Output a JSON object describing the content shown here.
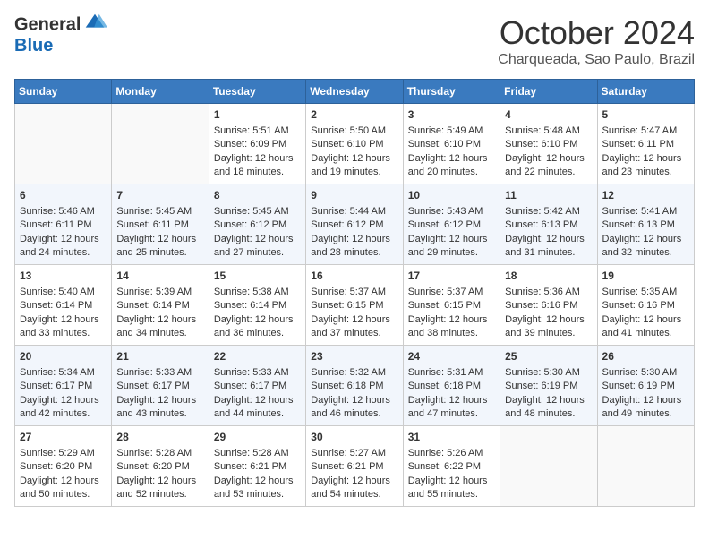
{
  "header": {
    "logo_line1": "General",
    "logo_line2": "Blue",
    "month_title": "October 2024",
    "subtitle": "Charqueada, Sao Paulo, Brazil"
  },
  "weekdays": [
    "Sunday",
    "Monday",
    "Tuesday",
    "Wednesday",
    "Thursday",
    "Friday",
    "Saturday"
  ],
  "weeks": [
    [
      {
        "day": "",
        "info": ""
      },
      {
        "day": "",
        "info": ""
      },
      {
        "day": "1",
        "info": "Sunrise: 5:51 AM\nSunset: 6:09 PM\nDaylight: 12 hours and 18 minutes."
      },
      {
        "day": "2",
        "info": "Sunrise: 5:50 AM\nSunset: 6:10 PM\nDaylight: 12 hours and 19 minutes."
      },
      {
        "day": "3",
        "info": "Sunrise: 5:49 AM\nSunset: 6:10 PM\nDaylight: 12 hours and 20 minutes."
      },
      {
        "day": "4",
        "info": "Sunrise: 5:48 AM\nSunset: 6:10 PM\nDaylight: 12 hours and 22 minutes."
      },
      {
        "day": "5",
        "info": "Sunrise: 5:47 AM\nSunset: 6:11 PM\nDaylight: 12 hours and 23 minutes."
      }
    ],
    [
      {
        "day": "6",
        "info": "Sunrise: 5:46 AM\nSunset: 6:11 PM\nDaylight: 12 hours and 24 minutes."
      },
      {
        "day": "7",
        "info": "Sunrise: 5:45 AM\nSunset: 6:11 PM\nDaylight: 12 hours and 25 minutes."
      },
      {
        "day": "8",
        "info": "Sunrise: 5:45 AM\nSunset: 6:12 PM\nDaylight: 12 hours and 27 minutes."
      },
      {
        "day": "9",
        "info": "Sunrise: 5:44 AM\nSunset: 6:12 PM\nDaylight: 12 hours and 28 minutes."
      },
      {
        "day": "10",
        "info": "Sunrise: 5:43 AM\nSunset: 6:12 PM\nDaylight: 12 hours and 29 minutes."
      },
      {
        "day": "11",
        "info": "Sunrise: 5:42 AM\nSunset: 6:13 PM\nDaylight: 12 hours and 31 minutes."
      },
      {
        "day": "12",
        "info": "Sunrise: 5:41 AM\nSunset: 6:13 PM\nDaylight: 12 hours and 32 minutes."
      }
    ],
    [
      {
        "day": "13",
        "info": "Sunrise: 5:40 AM\nSunset: 6:14 PM\nDaylight: 12 hours and 33 minutes."
      },
      {
        "day": "14",
        "info": "Sunrise: 5:39 AM\nSunset: 6:14 PM\nDaylight: 12 hours and 34 minutes."
      },
      {
        "day": "15",
        "info": "Sunrise: 5:38 AM\nSunset: 6:14 PM\nDaylight: 12 hours and 36 minutes."
      },
      {
        "day": "16",
        "info": "Sunrise: 5:37 AM\nSunset: 6:15 PM\nDaylight: 12 hours and 37 minutes."
      },
      {
        "day": "17",
        "info": "Sunrise: 5:37 AM\nSunset: 6:15 PM\nDaylight: 12 hours and 38 minutes."
      },
      {
        "day": "18",
        "info": "Sunrise: 5:36 AM\nSunset: 6:16 PM\nDaylight: 12 hours and 39 minutes."
      },
      {
        "day": "19",
        "info": "Sunrise: 5:35 AM\nSunset: 6:16 PM\nDaylight: 12 hours and 41 minutes."
      }
    ],
    [
      {
        "day": "20",
        "info": "Sunrise: 5:34 AM\nSunset: 6:17 PM\nDaylight: 12 hours and 42 minutes."
      },
      {
        "day": "21",
        "info": "Sunrise: 5:33 AM\nSunset: 6:17 PM\nDaylight: 12 hours and 43 minutes."
      },
      {
        "day": "22",
        "info": "Sunrise: 5:33 AM\nSunset: 6:17 PM\nDaylight: 12 hours and 44 minutes."
      },
      {
        "day": "23",
        "info": "Sunrise: 5:32 AM\nSunset: 6:18 PM\nDaylight: 12 hours and 46 minutes."
      },
      {
        "day": "24",
        "info": "Sunrise: 5:31 AM\nSunset: 6:18 PM\nDaylight: 12 hours and 47 minutes."
      },
      {
        "day": "25",
        "info": "Sunrise: 5:30 AM\nSunset: 6:19 PM\nDaylight: 12 hours and 48 minutes."
      },
      {
        "day": "26",
        "info": "Sunrise: 5:30 AM\nSunset: 6:19 PM\nDaylight: 12 hours and 49 minutes."
      }
    ],
    [
      {
        "day": "27",
        "info": "Sunrise: 5:29 AM\nSunset: 6:20 PM\nDaylight: 12 hours and 50 minutes."
      },
      {
        "day": "28",
        "info": "Sunrise: 5:28 AM\nSunset: 6:20 PM\nDaylight: 12 hours and 52 minutes."
      },
      {
        "day": "29",
        "info": "Sunrise: 5:28 AM\nSunset: 6:21 PM\nDaylight: 12 hours and 53 minutes."
      },
      {
        "day": "30",
        "info": "Sunrise: 5:27 AM\nSunset: 6:21 PM\nDaylight: 12 hours and 54 minutes."
      },
      {
        "day": "31",
        "info": "Sunrise: 5:26 AM\nSunset: 6:22 PM\nDaylight: 12 hours and 55 minutes."
      },
      {
        "day": "",
        "info": ""
      },
      {
        "day": "",
        "info": ""
      }
    ]
  ]
}
